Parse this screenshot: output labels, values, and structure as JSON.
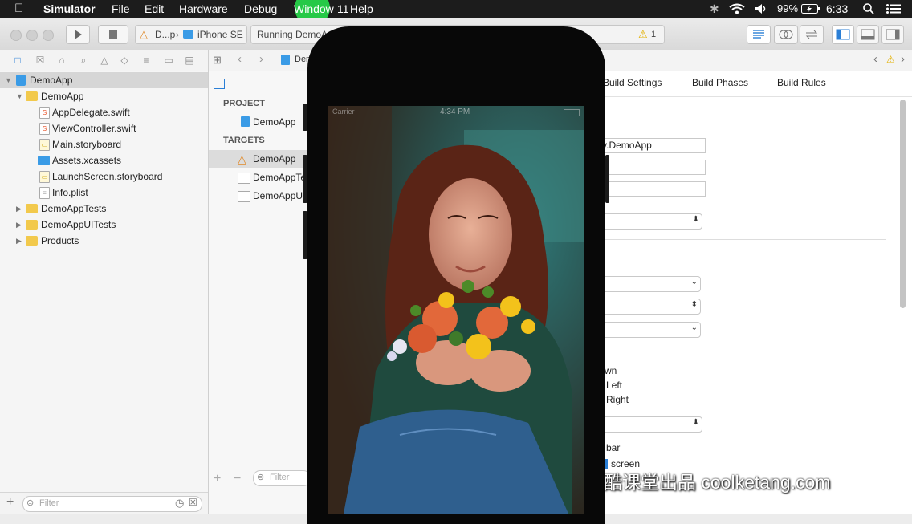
{
  "menubar": {
    "apple_icon": "apple-icon",
    "app_name": "Simulator",
    "items": [
      "File",
      "Edit",
      "Hardware",
      "Debug",
      "Window",
      "Help"
    ],
    "highlight_number": "11",
    "battery": "99%",
    "time": "6:33"
  },
  "toolbar": {
    "scheme_app": "D...p",
    "scheme_device": "iPhone SE",
    "activity": "Running DemoApp",
    "warning_count": "1"
  },
  "navigator": {
    "rows": [
      {
        "label": "DemoApp",
        "kind": "project"
      },
      {
        "label": "DemoApp",
        "kind": "folder"
      },
      {
        "label": "AppDelegate.swift",
        "kind": "swift"
      },
      {
        "label": "ViewController.swift",
        "kind": "swift"
      },
      {
        "label": "Main.storyboard",
        "kind": "storyboard"
      },
      {
        "label": "Assets.xcassets",
        "kind": "assets"
      },
      {
        "label": "LaunchScreen.storyboard",
        "kind": "storyboard"
      },
      {
        "label": "Info.plist",
        "kind": "plist"
      },
      {
        "label": "DemoAppTests",
        "kind": "folder"
      },
      {
        "label": "DemoAppUITests",
        "kind": "folder"
      },
      {
        "label": "Products",
        "kind": "folder"
      }
    ],
    "filter_placeholder": "Filter"
  },
  "jumpbar": {
    "crumb": "Dem"
  },
  "targets_list": {
    "project_header": "PROJECT",
    "project_item": "DemoApp",
    "targets_header": "TARGETS",
    "targets": [
      "DemoApp",
      "DemoAppTe",
      "DemoAppUI"
    ],
    "filter_placeholder": "Filter"
  },
  "editor": {
    "tabs": [
      "Build Settings",
      "Build Phases",
      "Build Rules"
    ],
    "bundle_id_partial": "y.DemoApp",
    "orientation_fragments": [
      "wn",
      "Left",
      "Right"
    ],
    "status_bar_fragments": [
      "bar",
      "screen"
    ]
  },
  "simulator": {
    "status_carrier": "Carrier",
    "status_time": "4:34 PM"
  },
  "watermark": "酷课堂出品 coolketang.com"
}
